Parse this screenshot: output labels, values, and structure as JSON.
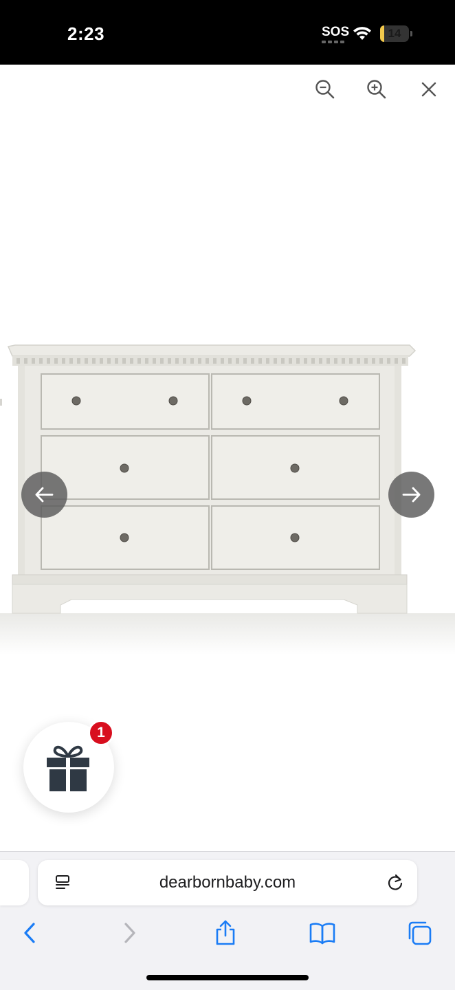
{
  "status_bar": {
    "time": "2:23",
    "carrier": "SOS",
    "battery_level": "14",
    "battery_fraction": 0.14,
    "icons": [
      "wifi-icon",
      "battery-icon"
    ]
  },
  "viewer_toolbar": {
    "icons": [
      "zoom-out-icon",
      "zoom-in-icon",
      "close-icon"
    ]
  },
  "product_image": {
    "subject": "white six-drawer double dresser"
  },
  "carousel": {
    "prev_icon": "arrow-left-icon",
    "next_icon": "arrow-right-icon"
  },
  "gift_widget": {
    "icon": "gift-icon",
    "badge_count": "1",
    "badge_color": "#d80e1e"
  },
  "browser": {
    "url": "dearbornbaby.com",
    "icons": [
      "reader-mode-icon",
      "reload-icon",
      "back-icon",
      "forward-icon",
      "share-icon",
      "bookmarks-icon",
      "tabs-icon"
    ],
    "accent_color": "#1a7cf5"
  }
}
